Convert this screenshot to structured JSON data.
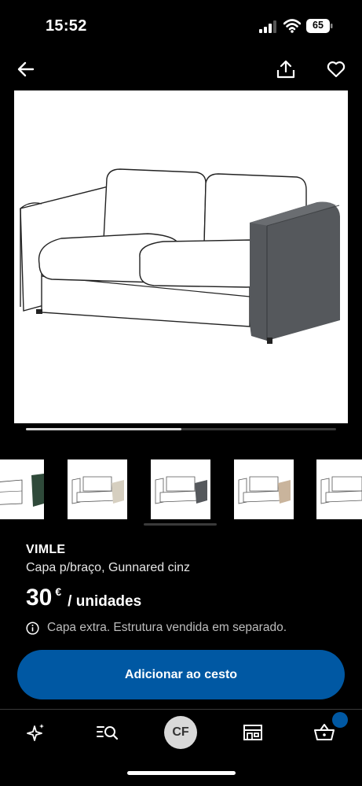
{
  "status_bar": {
    "time": "15:52",
    "battery": "65"
  },
  "nav": {
    "back_icon": "arrow-left-icon",
    "share_icon": "share-icon",
    "favourite_icon": "heart-icon"
  },
  "gallery": {
    "progress": 0.5
  },
  "product": {
    "brand": "VIMLE",
    "description": "Capa p/braço, Gunnared cinz",
    "price": "30",
    "currency": "€",
    "unit": "/ unidades",
    "note": "Capa extra. Estrutura vendida em separado."
  },
  "cta": {
    "label": "Adicionar ao cesto",
    "color": "#0058a3"
  },
  "tabbar": {
    "avatar_initials": "CF",
    "items": [
      "sparkle-icon",
      "search-list-icon",
      "avatar",
      "store-icon",
      "basket-icon"
    ]
  }
}
